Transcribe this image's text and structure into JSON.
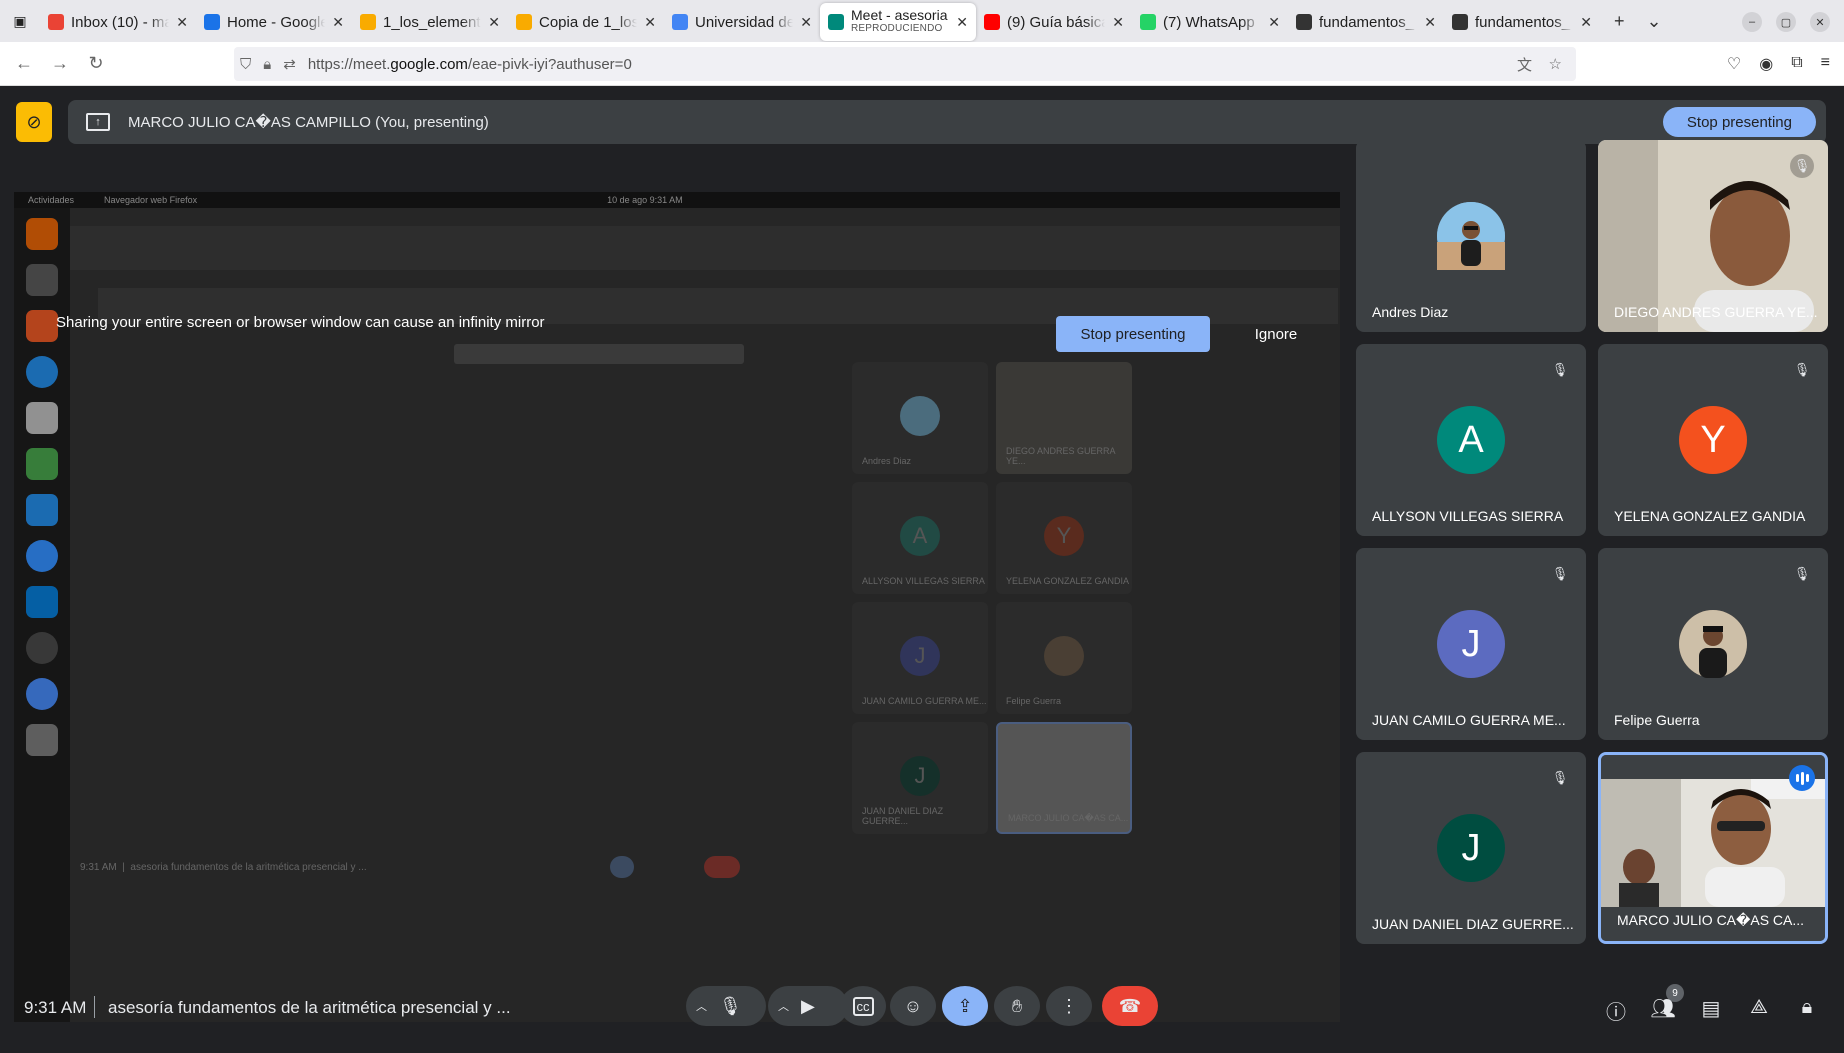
{
  "browser": {
    "tabs": [
      {
        "title": "Inbox (10) - ma",
        "icon": "gmail-icon",
        "color": "#ea4335"
      },
      {
        "title": "Home - Google",
        "icon": "google-drive-icon",
        "color": "#1a73e8"
      },
      {
        "title": "1_los_element",
        "icon": "colab-icon",
        "color": "#f9ab00"
      },
      {
        "title": "Copia de 1_los",
        "icon": "colab-icon",
        "color": "#f9ab00"
      },
      {
        "title": "Universidad de",
        "icon": "google-calendar-icon",
        "color": "#4285f4"
      },
      {
        "title": "Meet - asesoria",
        "subtitle": "REPRODUCIENDO",
        "icon": "google-meet-icon",
        "color": "#00897b",
        "active": true
      },
      {
        "title": "(9) Guía básica",
        "icon": "youtube-icon",
        "color": "#ff0000"
      },
      {
        "title": "(7) WhatsApp",
        "icon": "whatsapp-icon",
        "color": "#25d366"
      },
      {
        "title": "fundamentos_",
        "icon": "github-icon",
        "color": "#333333"
      },
      {
        "title": "fundamentos_",
        "icon": "github-icon",
        "color": "#333333"
      }
    ],
    "url_prefix": "https://meet.",
    "url_domain": "google.com",
    "url_suffix": "/eae-pivk-iyi?authuser=0"
  },
  "presenting_bar": {
    "text": "MARCO JULIO CA�AS CAMPILLO (You, presenting)",
    "stop_label": "Stop presenting"
  },
  "shared_screen": {
    "warning": "Sharing your entire screen or browser window can cause an infinity mirror",
    "stop_label": "Stop presenting",
    "ignore_label": "Ignore",
    "mini_topbar": [
      "Actividades",
      "Navegador web Firefox",
      "10 de ago  9:31 AM"
    ]
  },
  "participants": [
    {
      "name": "Andres Diaz",
      "type": "photo-avatar",
      "muted": false
    },
    {
      "name": "DIEGO ANDRES GUERRA YE...",
      "type": "video",
      "muted": true
    },
    {
      "name": "ALLYSON VILLEGAS SIERRA",
      "initial": "A",
      "color": "#00897b",
      "muted": true
    },
    {
      "name": "YELENA GONZALEZ GANDIA",
      "initial": "Y",
      "color": "#f4511e",
      "muted": true
    },
    {
      "name": "JUAN CAMILO GUERRA ME...",
      "initial": "J",
      "color": "#5c6bc0",
      "muted": true
    },
    {
      "name": "Felipe Guerra",
      "type": "photo-avatar",
      "muted": true
    },
    {
      "name": "JUAN DANIEL DIAZ GUERRE...",
      "initial": "J",
      "color": "#004d40",
      "muted": true
    },
    {
      "name": "MARCO JULIO CA�AS CA...",
      "type": "video",
      "speaking": true
    }
  ],
  "bottom_bar": {
    "time": "9:31 AM",
    "meeting_title": "asesoría fundamentos de la aritmética presencial y ...",
    "people_count": "9"
  }
}
